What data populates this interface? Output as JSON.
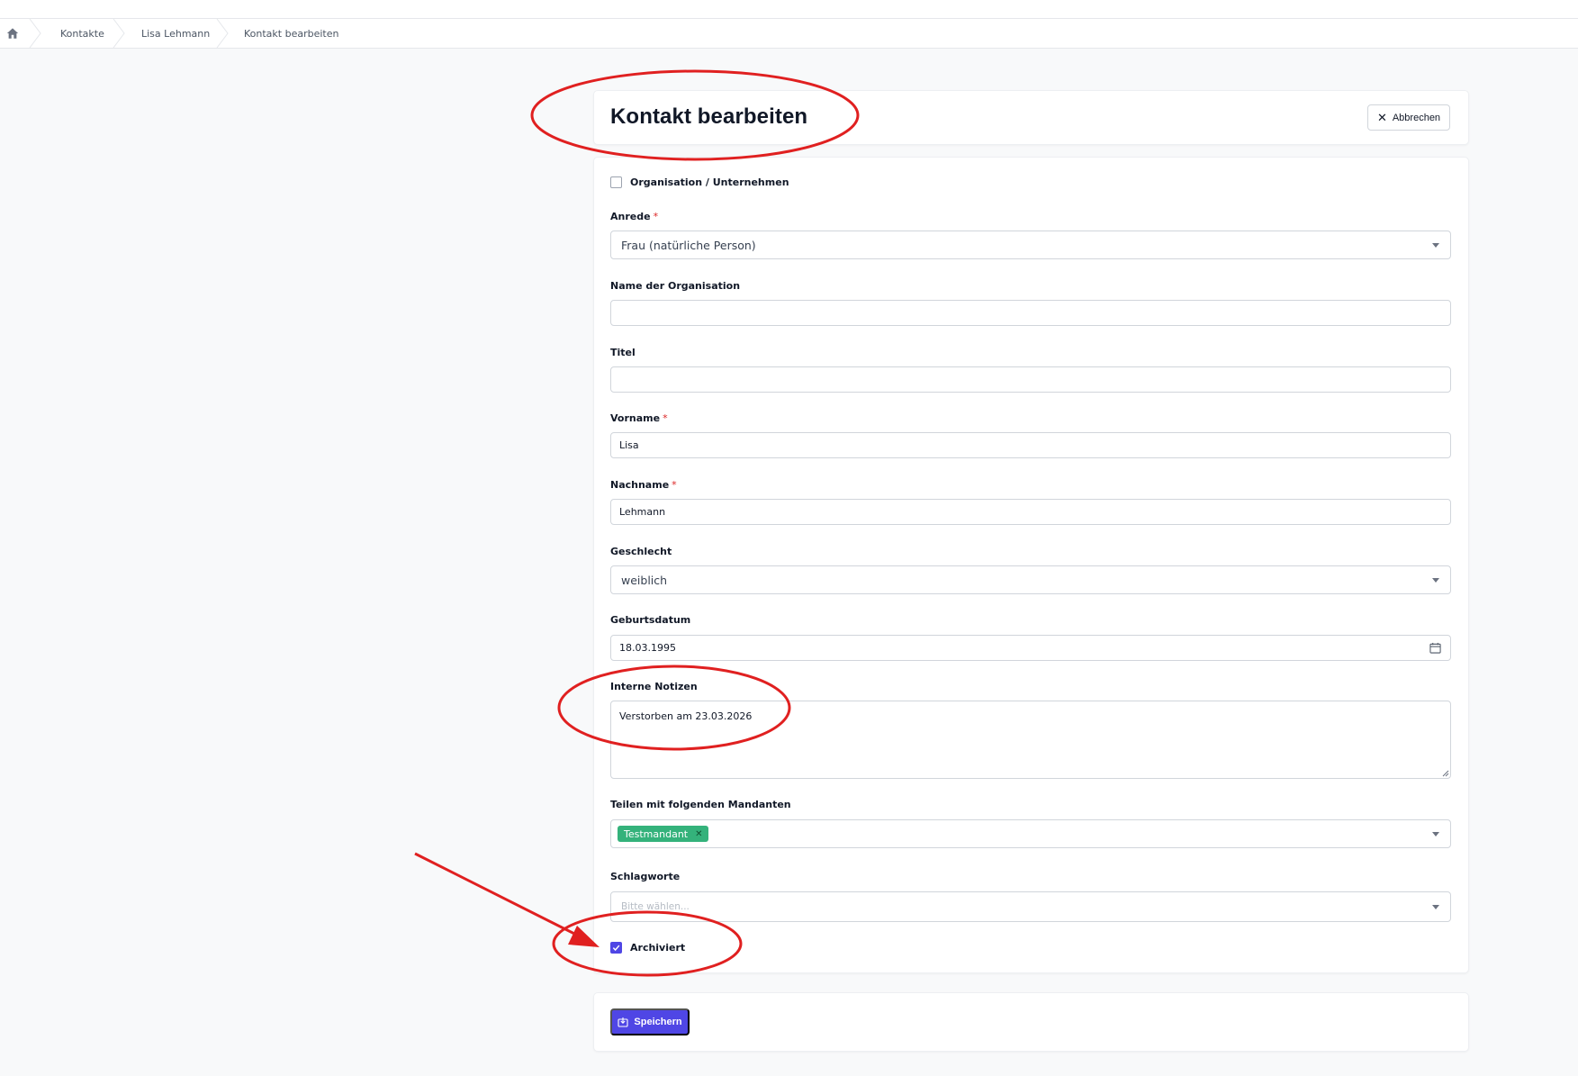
{
  "breadcrumb": {
    "items": [
      "Kontakte",
      "Lisa Lehmann",
      "Kontakt bearbeiten"
    ]
  },
  "header": {
    "title": "Kontakt bearbeiten",
    "cancel_label": "Abbrechen"
  },
  "form": {
    "org_checkbox_label": "Organisation / Unternehmen",
    "org_checked": false,
    "salutation": {
      "label": "Anrede",
      "value": "Frau (natürliche Person)"
    },
    "org_name": {
      "label": "Name der Organisation",
      "value": ""
    },
    "title": {
      "label": "Titel",
      "value": ""
    },
    "first_name": {
      "label": "Vorname",
      "value": "Lisa"
    },
    "last_name": {
      "label": "Nachname",
      "value": "Lehmann"
    },
    "gender": {
      "label": "Geschlecht",
      "value": "weiblich"
    },
    "birthdate": {
      "label": "Geburtsdatum",
      "value": "18.03.1995"
    },
    "notes": {
      "label": "Interne Notizen",
      "value": "Verstorben am 23.03.2026"
    },
    "share": {
      "label": "Teilen mit folgenden Mandanten",
      "tags": [
        "Testmandant"
      ]
    },
    "keywords": {
      "label": "Schlagworte",
      "placeholder": "Bitte wählen..."
    },
    "archived_label": "Archiviert",
    "archived_checked": true,
    "required_mark": "*"
  },
  "footer": {
    "save_label": "Speichern"
  },
  "colors": {
    "accent": "#4f46e5",
    "tag": "#34b27b",
    "annotation": "#e02020",
    "required": "#dc2626"
  }
}
